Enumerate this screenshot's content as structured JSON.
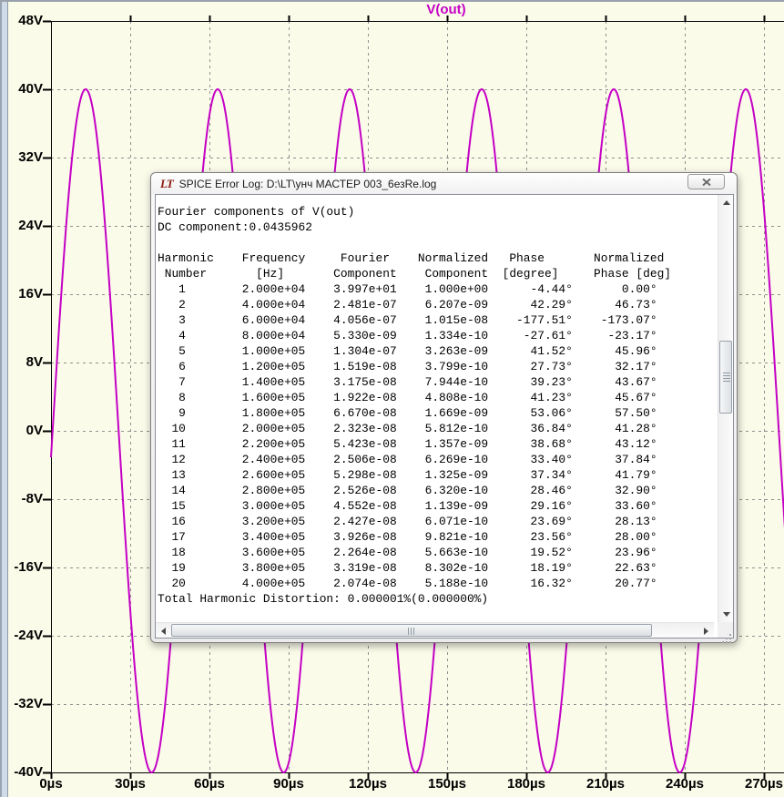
{
  "chart_data": {
    "type": "line",
    "title": "V(out)",
    "trace_color": "#C400C4",
    "background": "#FBFBEA",
    "x_axis": {
      "unit": "µs",
      "tick_labels": [
        "0µs",
        "30µs",
        "60µs",
        "90µs",
        "120µs",
        "150µs",
        "180µs",
        "210µs",
        "240µs",
        "270µs"
      ],
      "tick_values_us": [
        0,
        30,
        60,
        90,
        120,
        150,
        180,
        210,
        240,
        270
      ],
      "t_end_us": 278
    },
    "y_axis": {
      "unit": "V",
      "tick_labels": [
        "48V",
        "40V",
        "32V",
        "24V",
        "16V",
        "8V",
        "0V",
        "-8V",
        "-16V",
        "-24V",
        "-32V",
        "-40V"
      ],
      "tick_values_v": [
        48,
        40,
        32,
        24,
        16,
        8,
        0,
        -8,
        -16,
        -24,
        -32,
        -40
      ]
    },
    "waveform": {
      "shape": "sine",
      "amplitude_V": 40,
      "period_us": 50,
      "phase_deg": -4.44,
      "dc_offset_V": 0
    }
  },
  "dialog": {
    "title": "SPICE Error Log: D:\\LT\\унч МАСТЕР 003_6езRe.log",
    "logo": "LT",
    "log": {
      "line1": "Fourier components of V(out)",
      "line2": "DC component:0.0435962",
      "header1": [
        "Harmonic",
        "Frequency",
        "Fourier",
        "Normalized",
        "Phase",
        "Normalized"
      ],
      "header2": [
        "Number",
        "[Hz]",
        "Component",
        "Component",
        "[degree]",
        "Phase [deg]"
      ],
      "rows": [
        [
          "1",
          "2.000e+04",
          "3.997e+01",
          "1.000e+00",
          "-4.44°",
          "0.00°"
        ],
        [
          "2",
          "4.000e+04",
          "2.481e-07",
          "6.207e-09",
          "42.29°",
          "46.73°"
        ],
        [
          "3",
          "6.000e+04",
          "4.056e-07",
          "1.015e-08",
          "-177.51°",
          "-173.07°"
        ],
        [
          "4",
          "8.000e+04",
          "5.330e-09",
          "1.334e-10",
          "-27.61°",
          "-23.17°"
        ],
        [
          "5",
          "1.000e+05",
          "1.304e-07",
          "3.263e-09",
          "41.52°",
          "45.96°"
        ],
        [
          "6",
          "1.200e+05",
          "1.519e-08",
          "3.799e-10",
          "27.73°",
          "32.17°"
        ],
        [
          "7",
          "1.400e+05",
          "3.175e-08",
          "7.944e-10",
          "39.23°",
          "43.67°"
        ],
        [
          "8",
          "1.600e+05",
          "1.922e-08",
          "4.808e-10",
          "41.23°",
          "45.67°"
        ],
        [
          "9",
          "1.800e+05",
          "6.670e-08",
          "1.669e-09",
          "53.06°",
          "57.50°"
        ],
        [
          "10",
          "2.000e+05",
          "2.323e-08",
          "5.812e-10",
          "36.84°",
          "41.28°"
        ],
        [
          "11",
          "2.200e+05",
          "5.423e-08",
          "1.357e-09",
          "38.68°",
          "43.12°"
        ],
        [
          "12",
          "2.400e+05",
          "2.506e-08",
          "6.269e-10",
          "33.40°",
          "37.84°"
        ],
        [
          "13",
          "2.600e+05",
          "5.298e-08",
          "1.325e-09",
          "37.34°",
          "41.79°"
        ],
        [
          "14",
          "2.800e+05",
          "2.526e-08",
          "6.320e-10",
          "28.46°",
          "32.90°"
        ],
        [
          "15",
          "3.000e+05",
          "4.552e-08",
          "1.139e-09",
          "29.16°",
          "33.60°"
        ],
        [
          "16",
          "3.200e+05",
          "2.427e-08",
          "6.071e-10",
          "23.69°",
          "28.13°"
        ],
        [
          "17",
          "3.400e+05",
          "3.926e-08",
          "9.821e-10",
          "23.56°",
          "28.00°"
        ],
        [
          "18",
          "3.600e+05",
          "2.264e-08",
          "5.663e-10",
          "19.52°",
          "23.96°"
        ],
        [
          "19",
          "3.800e+05",
          "3.319e-08",
          "8.302e-10",
          "18.19°",
          "22.63°"
        ],
        [
          "20",
          "4.000e+05",
          "2.074e-08",
          "5.188e-10",
          "16.32°",
          "20.77°"
        ]
      ],
      "thd": "Total Harmonic Distortion: 0.000001%(0.000000%)"
    }
  }
}
